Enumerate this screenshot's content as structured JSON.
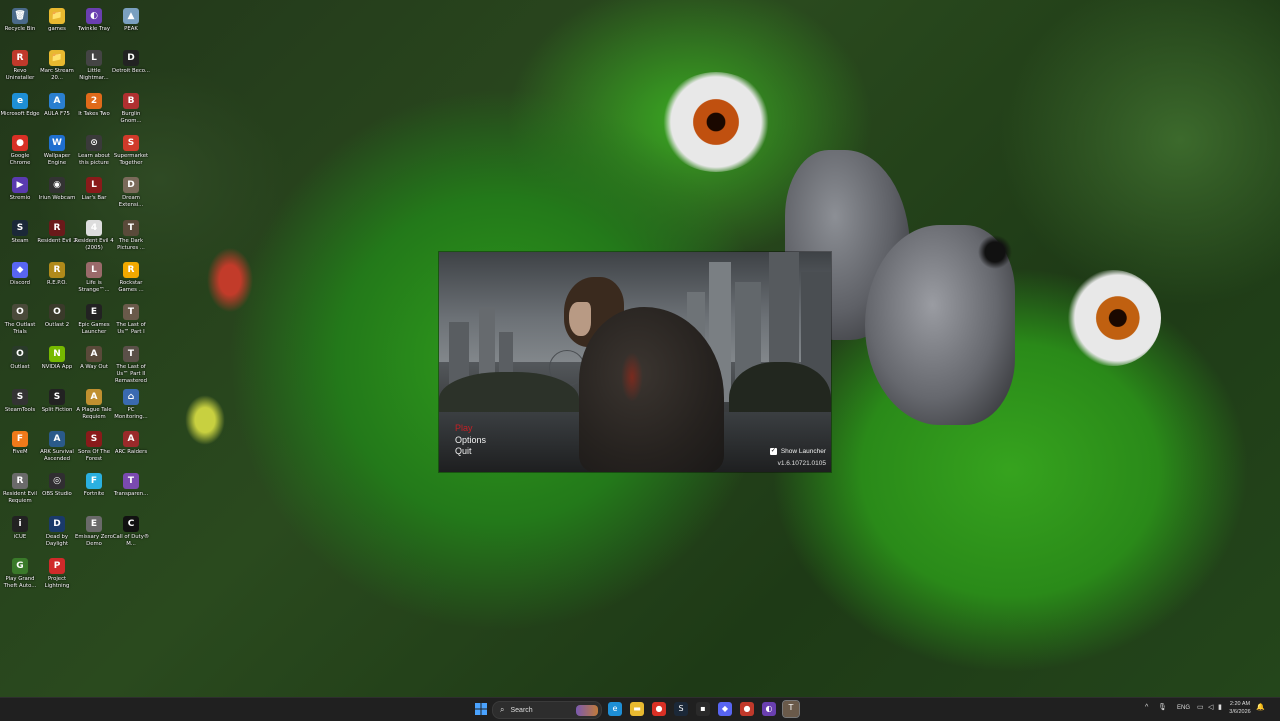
{
  "desktop": {
    "icons": [
      {
        "label": "Recycle Bin",
        "glyph": "🗑",
        "color": "#4a6a8a"
      },
      {
        "label": "games",
        "glyph": "📁",
        "color": "#e8b930"
      },
      {
        "label": "Twinkle Tray",
        "glyph": "◐",
        "color": "#6a3fb0"
      },
      {
        "label": "PEAK",
        "glyph": "▲",
        "color": "#7aa0c0"
      },
      {
        "label": "Revo Uninstaller",
        "glyph": "R",
        "color": "#c0392b"
      },
      {
        "label": "Marc Stream 20...",
        "glyph": "📁",
        "color": "#e8b930"
      },
      {
        "label": "Little Nightmar...",
        "glyph": "L",
        "color": "#444"
      },
      {
        "label": "Detroit Beco...",
        "glyph": "D",
        "color": "#222"
      },
      {
        "label": "Microsoft Edge",
        "glyph": "e",
        "color": "#1e8fd6"
      },
      {
        "label": "AULA F75",
        "glyph": "A",
        "color": "#2a7fd0"
      },
      {
        "label": "It Takes Two",
        "glyph": "2",
        "color": "#e06a1a"
      },
      {
        "label": "Burglin Gnom...",
        "glyph": "B",
        "color": "#b03030"
      },
      {
        "label": "Google Chrome",
        "glyph": "●",
        "color": "#d93025"
      },
      {
        "label": "Wallpaper Engine",
        "glyph": "W",
        "color": "#1f6fd0"
      },
      {
        "label": "Learn about this picture",
        "glyph": "⊙",
        "color": "#3a3a3a"
      },
      {
        "label": "Supermarket Together",
        "glyph": "S",
        "color": "#d03a2a"
      },
      {
        "label": "Stremio",
        "glyph": "▶",
        "color": "#5a3ab0"
      },
      {
        "label": "Iriun Webcam",
        "glyph": "◉",
        "color": "#333"
      },
      {
        "label": "Liar's Bar",
        "glyph": "L",
        "color": "#8a1a1a"
      },
      {
        "label": "Dream Extensi...",
        "glyph": "D",
        "color": "#7a6a5a"
      },
      {
        "label": "Steam",
        "glyph": "S",
        "color": "#1b2838"
      },
      {
        "label": "Resident Evil 2",
        "glyph": "R",
        "color": "#6a1a1a"
      },
      {
        "label": "Resident Evil 4 (2005)",
        "glyph": "4",
        "color": "#ddd"
      },
      {
        "label": "The Dark Pictures ...",
        "glyph": "T",
        "color": "#5a4a3a"
      },
      {
        "label": "Discord",
        "glyph": "◆",
        "color": "#5865f2"
      },
      {
        "label": "R.E.P.O.",
        "glyph": "R",
        "color": "#b08a1a"
      },
      {
        "label": "Life is Strange™...",
        "glyph": "L",
        "color": "#9a6a6a"
      },
      {
        "label": "Rockstar Games ...",
        "glyph": "R",
        "color": "#f2a900"
      },
      {
        "label": "The Outlast Trials",
        "glyph": "O",
        "color": "#4a4a3a"
      },
      {
        "label": "Outlast 2",
        "glyph": "O",
        "color": "#3a3a2a"
      },
      {
        "label": "Epic Games Launcher",
        "glyph": "E",
        "color": "#222"
      },
      {
        "label": "The Last of Us™ Part I",
        "glyph": "T",
        "color": "#6a5a4a"
      },
      {
        "label": "Outlast",
        "glyph": "O",
        "color": "#2a3a2a"
      },
      {
        "label": "NVIDIA App",
        "glyph": "N",
        "color": "#76b900"
      },
      {
        "label": "A Way Out",
        "glyph": "A",
        "color": "#5a4a3a"
      },
      {
        "label": "The Last of Us™ Part II Remastered",
        "glyph": "T",
        "color": "#5a5048"
      },
      {
        "label": "SteamTools",
        "glyph": "S",
        "color": "#333"
      },
      {
        "label": "Split Fiction",
        "glyph": "S",
        "color": "#222"
      },
      {
        "label": "A Plague Tale Requiem",
        "glyph": "A",
        "color": "#c09030"
      },
      {
        "label": "PC Monitoring...",
        "glyph": "⌂",
        "color": "#3a6ab0"
      },
      {
        "label": "FiveM",
        "glyph": "F",
        "color": "#f07a1a"
      },
      {
        "label": "ARK Survival Ascended",
        "glyph": "A",
        "color": "#2a5a8a"
      },
      {
        "label": "Sons Of The Forest",
        "glyph": "S",
        "color": "#8a1a1a"
      },
      {
        "label": "ARC Raiders",
        "glyph": "A",
        "color": "#9a2a2a"
      },
      {
        "label": "Resident Evil Requiem",
        "glyph": "R",
        "color": "#6a6a6a"
      },
      {
        "label": "OBS Studio",
        "glyph": "◎",
        "color": "#302e31"
      },
      {
        "label": "Fortnite",
        "glyph": "F",
        "color": "#2ab0e0"
      },
      {
        "label": "Transparen...",
        "glyph": "T",
        "color": "#7a4ab0"
      },
      {
        "label": "iCUE",
        "glyph": "i",
        "color": "#222"
      },
      {
        "label": "Dead by Daylight",
        "glyph": "D",
        "color": "#1a3a6a"
      },
      {
        "label": "Emissary Zero Demo",
        "glyph": "E",
        "color": "#6a6a6a"
      },
      {
        "label": "Call of Duty® M...",
        "glyph": "C",
        "color": "#111"
      },
      {
        "label": "Play Grand Theft Auto...",
        "glyph": "G",
        "color": "#3a7a2a"
      },
      {
        "label": "Project Lightning",
        "glyph": "P",
        "color": "#d02a2a"
      }
    ]
  },
  "launcher": {
    "menu": [
      {
        "label": "Play",
        "active": true
      },
      {
        "label": "Options",
        "active": false
      },
      {
        "label": "Quit",
        "active": false
      }
    ],
    "show_launcher_label": "Show Launcher",
    "show_launcher_checked": true,
    "checkbox_glyph": "✓",
    "version": "v1.6.10721.0105"
  },
  "taskbar": {
    "search_placeholder": "Search",
    "search_glyph": "⌕",
    "start_color": "#3a8ee6",
    "apps": [
      {
        "name": "edge",
        "glyph": "e",
        "color": "#1e8fd6"
      },
      {
        "name": "file-explorer",
        "glyph": "▬",
        "color": "#e8b930"
      },
      {
        "name": "chrome",
        "glyph": "●",
        "color": "#d93025"
      },
      {
        "name": "steam",
        "glyph": "S",
        "color": "#1b2838"
      },
      {
        "name": "terminal",
        "glyph": "▪",
        "color": "#2a2a2a"
      },
      {
        "name": "discord",
        "glyph": "◆",
        "color": "#5865f2"
      },
      {
        "name": "chrome-alt",
        "glyph": "●",
        "color": "#c0392b"
      },
      {
        "name": "twinkle-tray",
        "glyph": "◐",
        "color": "#6a3fb0"
      },
      {
        "name": "tlou-launcher",
        "glyph": "T",
        "color": "#6a5a4a"
      }
    ],
    "tray": {
      "chevron": "^",
      "mic": "🎙",
      "language": "ENG",
      "clock_time": "2:20 AM",
      "clock_date": "3/6/2026"
    }
  }
}
